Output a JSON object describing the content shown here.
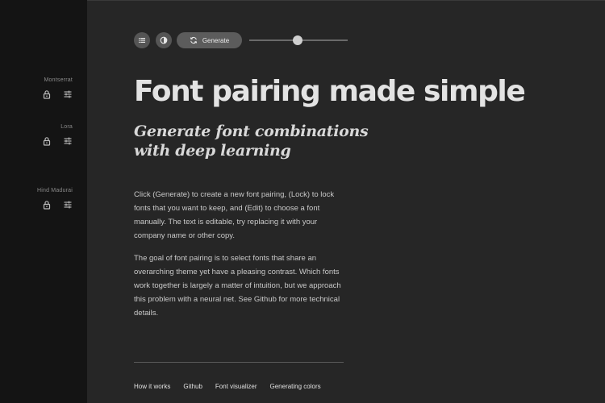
{
  "sidebar": {
    "fonts": [
      {
        "name": "Montserrat",
        "lock_icon": "lock-icon",
        "edit_icon": "sliders-icon"
      },
      {
        "name": "Lora",
        "lock_icon": "lock-icon",
        "edit_icon": "sliders-icon"
      },
      {
        "name": "Hind Madurai",
        "lock_icon": "lock-icon",
        "edit_icon": "sliders-icon"
      }
    ]
  },
  "toolbar": {
    "list_icon": "list-icon",
    "contrast_icon": "contrast-icon",
    "generate_label": "Generate",
    "generate_icon": "refresh-icon",
    "slider_level": 0.49
  },
  "main": {
    "headline": "Font pairing made simple",
    "subhead": "Generate font combinations with deep learning",
    "paragraph_1": "Click (Generate) to create a new font pairing, (Lock) to lock fonts that you want to keep, and (Edit) to choose a font manually. The text is editable, try replacing it with your company name or other copy.",
    "paragraph_2": "The goal of font pairing is to select fonts that share an overarching theme yet have a pleasing contrast. Which fonts work together is largely a matter of intuition, but we approach this problem with a neural net. See Github for more technical details."
  },
  "footer": {
    "links": [
      "How it works",
      "Github",
      "Font visualizer",
      "Generating colors"
    ]
  },
  "colors": {
    "background": "#262626",
    "sidebar": "#141414",
    "button": "#555555",
    "text": "#d6d6d6"
  }
}
